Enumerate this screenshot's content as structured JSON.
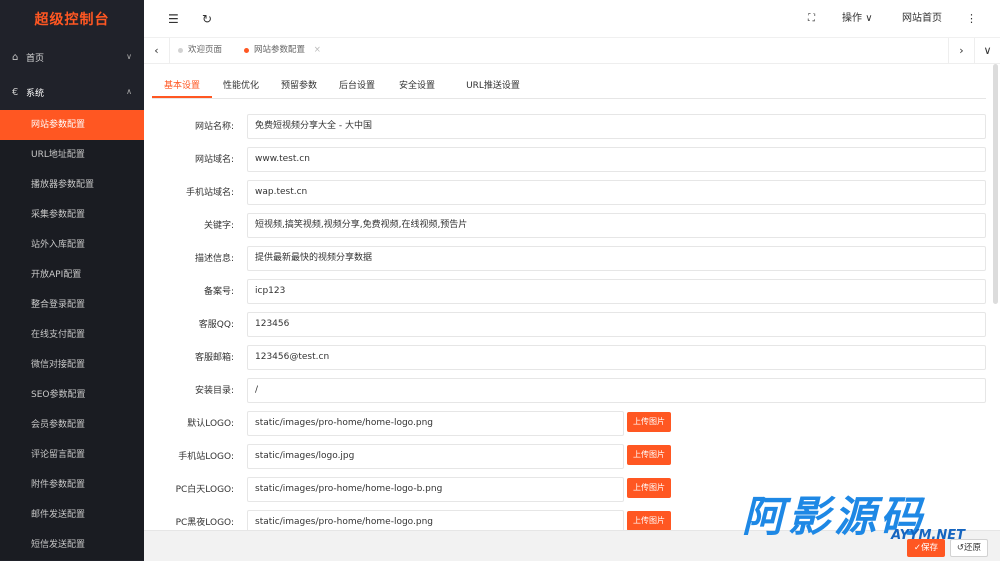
{
  "sidebar": {
    "logo": "超级控制台",
    "home": "首页",
    "system": "系统",
    "items": [
      "网站参数配置",
      "URL地址配置",
      "播放器参数配置",
      "采集参数配置",
      "站外入库配置",
      "开放API配置",
      "整合登录配置",
      "在线支付配置",
      "微信对接配置",
      "SEO参数配置",
      "会员参数配置",
      "评论留言配置",
      "附件参数配置",
      "邮件发送配置",
      "短信发送配置"
    ]
  },
  "header": {
    "operate": "操作",
    "site_home": "网站首页"
  },
  "tabs": {
    "welcome": "欢迎页面",
    "current": "网站参数配置"
  },
  "content_tabs": [
    "基本设置",
    "性能优化",
    "预留参数",
    "后台设置",
    "安全设置",
    "URL推送设置"
  ],
  "form": {
    "site_name_label": "网站名称:",
    "site_name": "免费短视频分享大全 - 大中国",
    "domain_label": "网站域名:",
    "domain": "www.test.cn",
    "wap_label": "手机站域名:",
    "wap": "wap.test.cn",
    "keywords_label": "关键字:",
    "keywords": "短视频,搞笑视频,视频分享,免费视频,在线视频,预告片",
    "desc_label": "描述信息:",
    "desc": "提供最新最快的视频分享数据",
    "icp_label": "备案号:",
    "icp": "icp123",
    "qq_label": "客服QQ:",
    "qq": "123456",
    "email_label": "客服邮箱:",
    "email": "123456@test.cn",
    "dir_label": "安装目录:",
    "dir": "/",
    "logo_label": "默认LOGO:",
    "logo": "static/images/pro-home/home-logo.png",
    "wap_logo_label": "手机站LOGO:",
    "wap_logo": "static/images/logo.jpg",
    "pc_day_logo_label": "PC白天LOGO:",
    "pc_day_logo": "static/images/pro-home/home-logo-b.png",
    "pc_night_logo_label": "PC黑夜LOGO:",
    "pc_night_logo": "static/images/pro-home/home-logo.png",
    "upload": "上传图片"
  },
  "footer": {
    "save": "保存",
    "reset": "还原"
  },
  "watermark": {
    "text": "阿影源码",
    "sub": "AYYM.NET"
  },
  "colors": {
    "accent": "#ff5722",
    "sidebar_bg": "#20222a"
  }
}
